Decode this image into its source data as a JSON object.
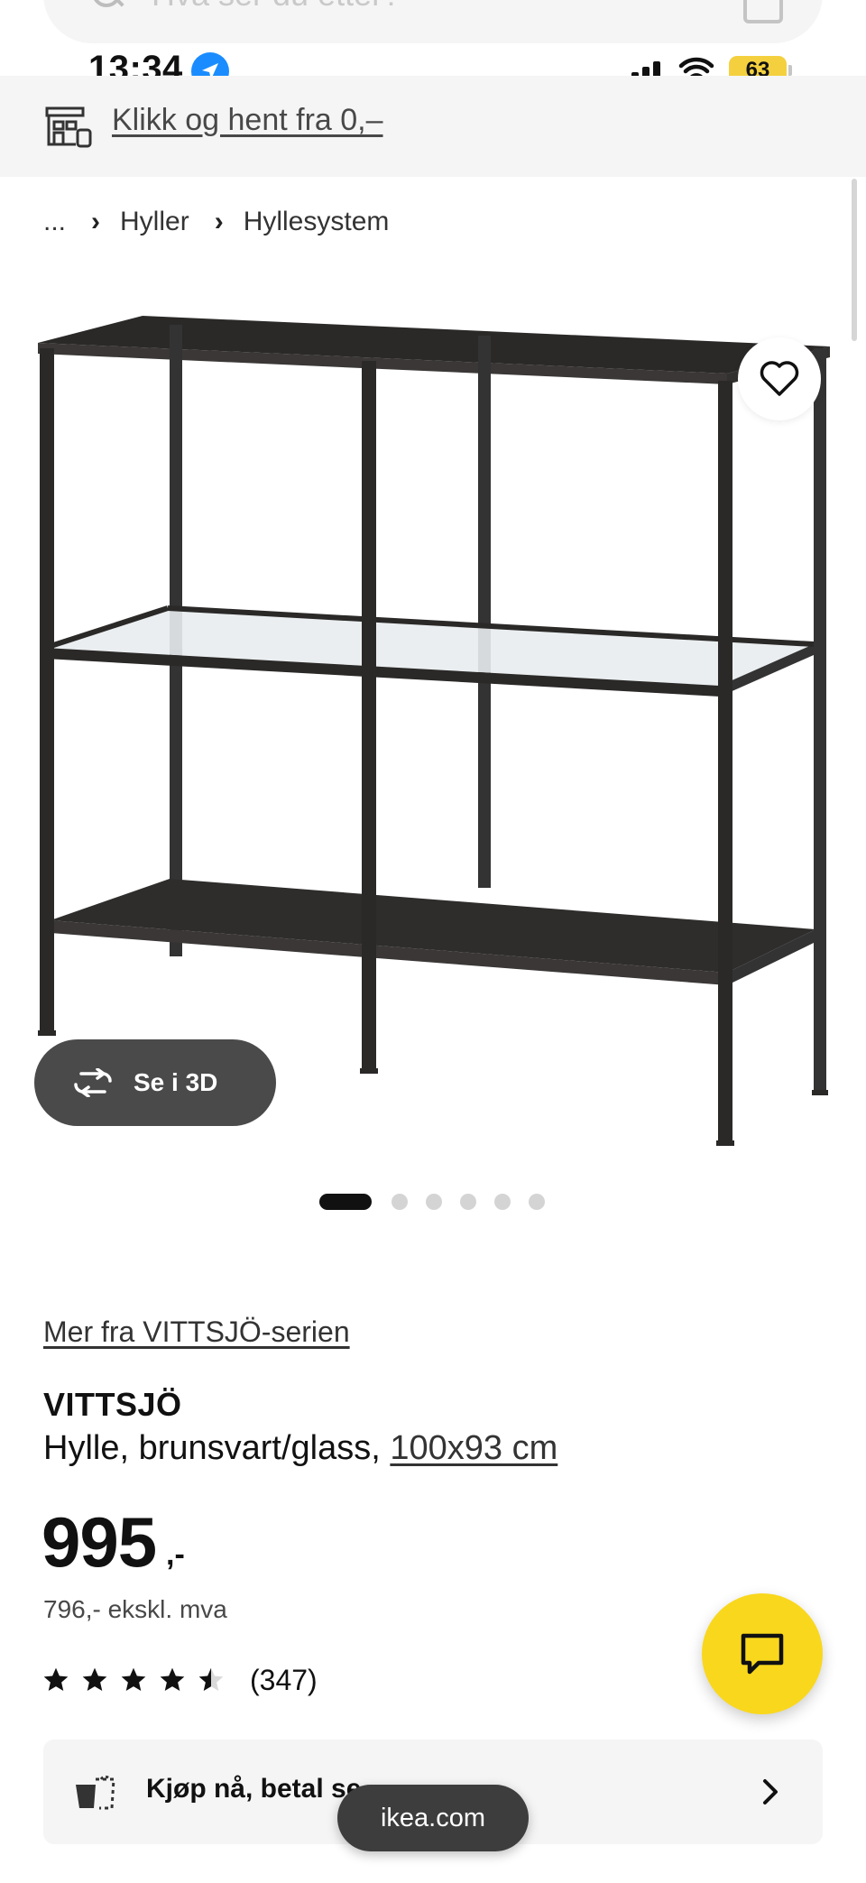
{
  "search": {
    "placeholder": "Hva ser du etter?"
  },
  "status_bar": {
    "time": "13:34",
    "battery": "63"
  },
  "collect_banner": {
    "text": "Klikk og hent fra 0,–"
  },
  "breadcrumb": {
    "ellipsis": "...",
    "items": [
      "Hyller",
      "Hyllesystem"
    ]
  },
  "gallery": {
    "view_3d_label": "Se i 3D",
    "image_count": 6,
    "active_index": 0
  },
  "product": {
    "series_link": "Mer fra VITTSJÖ-serien",
    "name": "VITTSJÖ",
    "description": "Hylle, brunsvart/glass,",
    "size": "100x93 cm",
    "price": "995",
    "price_suffix": ",-",
    "price_ex_vat": "796,- ekskl. mva",
    "rating": 4.5,
    "rating_count": "(347)"
  },
  "buy_now": {
    "text": "Kjøp nå, betal se..."
  },
  "browser": {
    "url": "ikea.com"
  },
  "colors": {
    "accent_yellow": "#f9d71c",
    "dark_button": "#4a4a4a",
    "banner_bg": "#f5f5f5"
  }
}
